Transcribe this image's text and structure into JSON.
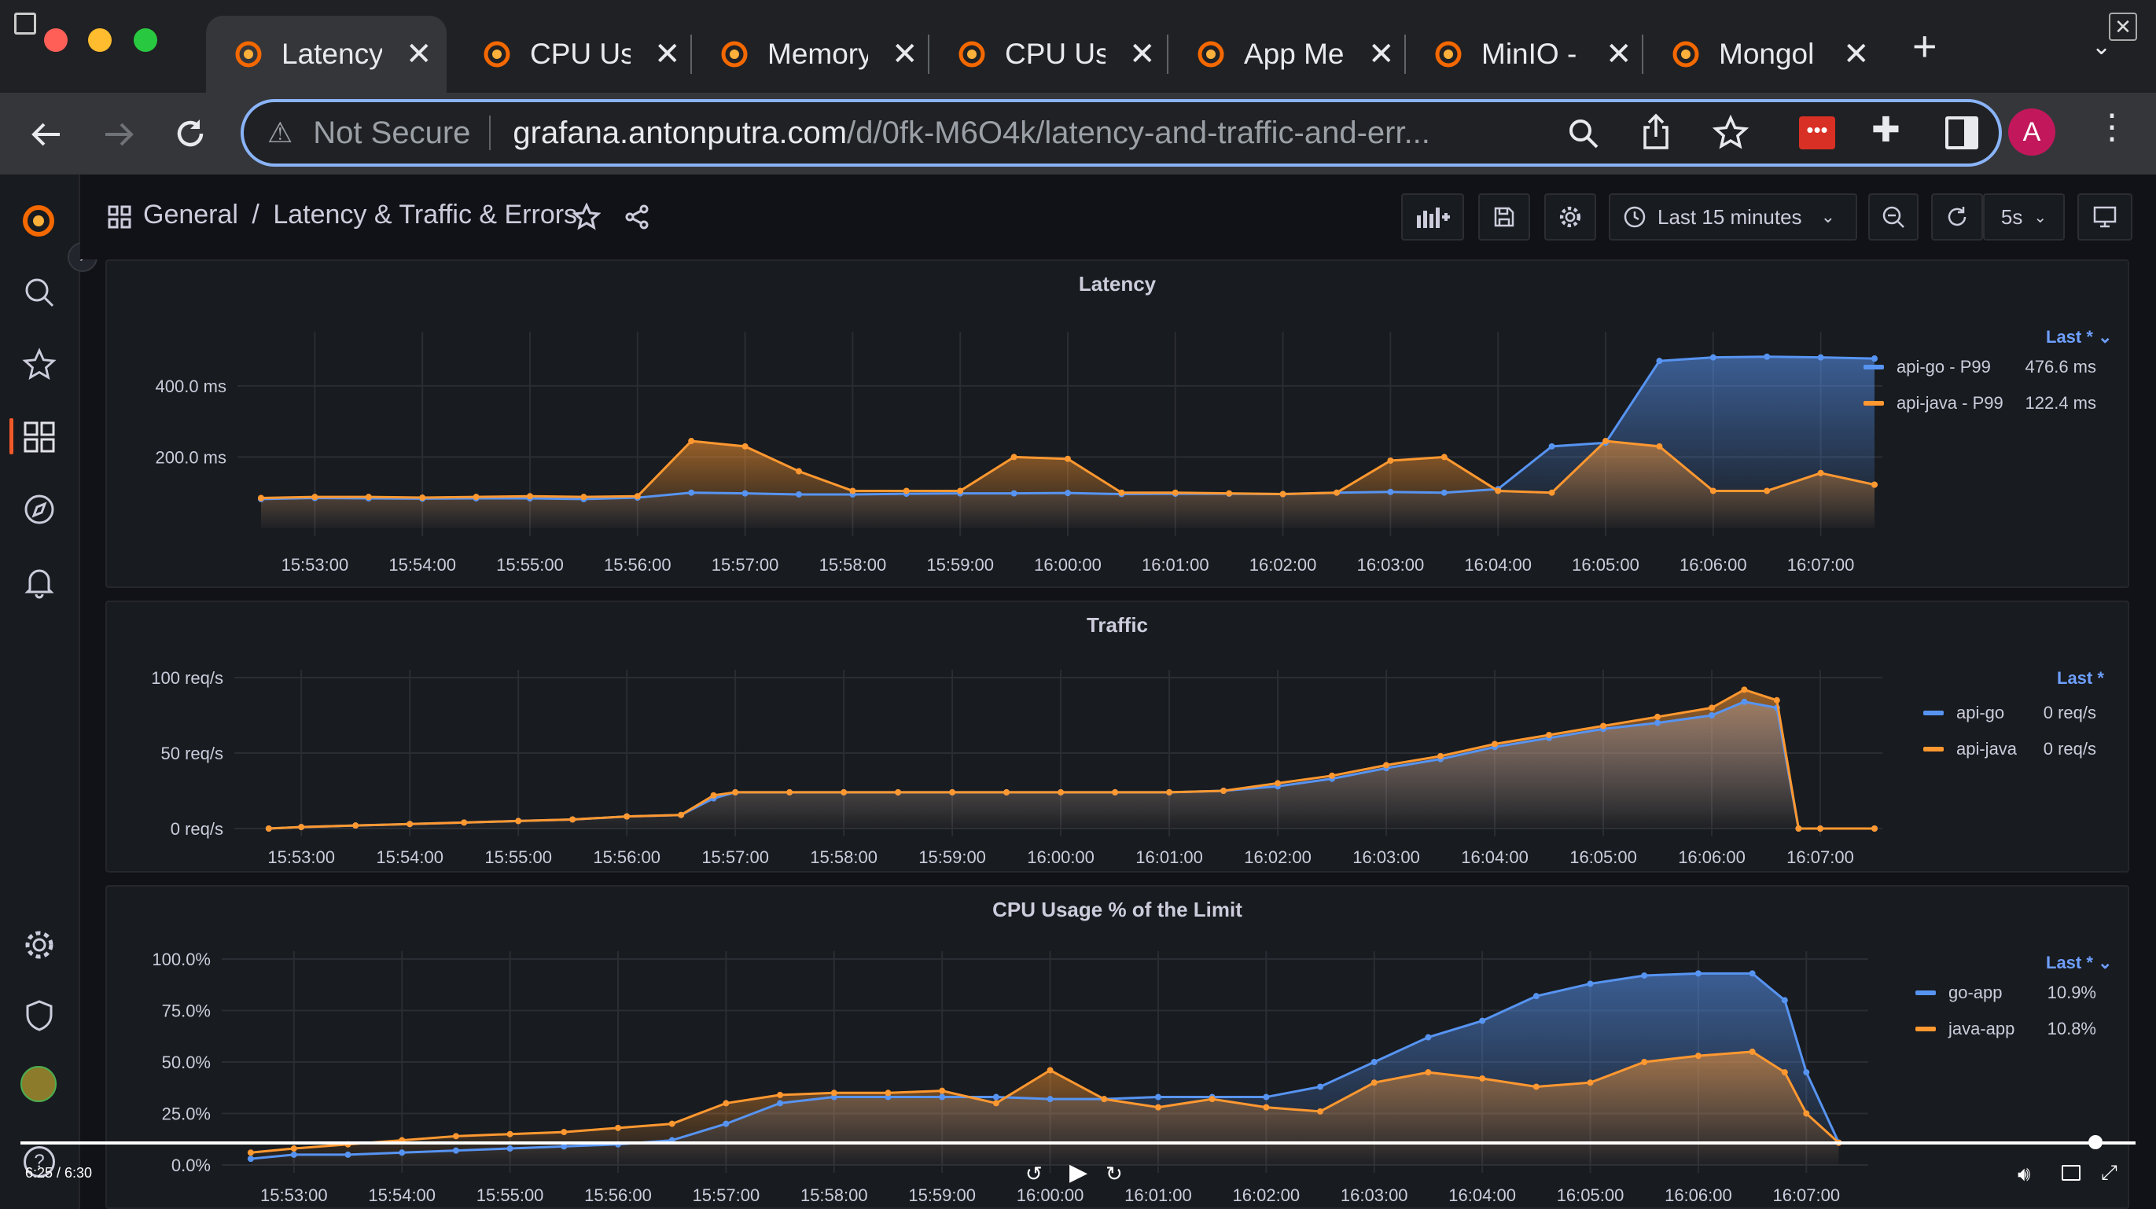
{
  "browser": {
    "tabs": [
      {
        "label": "Latency",
        "active": true
      },
      {
        "label": "CPU Us"
      },
      {
        "label": "Memory"
      },
      {
        "label": "CPU Us"
      },
      {
        "label": "App Me"
      },
      {
        "label": "MinIO -"
      },
      {
        "label": "Mongol"
      }
    ],
    "not_secure": "Not Secure",
    "url_host": "grafana.antonputra.com",
    "url_path": "/d/0fk-M6O4k/latency-and-traffic-and-err...",
    "profile_initial": "A"
  },
  "dashboard": {
    "folder": "General",
    "separator": "/",
    "title": "Latency & Traffic & Errors",
    "time_range": "Last 15 minutes",
    "refresh": "5s"
  },
  "colors": {
    "blue": "#5794f2",
    "orange": "#ff9830"
  },
  "panels": {
    "latency": {
      "legend_header": "Last * ⌄",
      "legend": [
        {
          "name": "api-go - P99",
          "value": "476.6 ms"
        },
        {
          "name": "api-java - P99",
          "value": "122.4 ms"
        }
      ]
    },
    "traffic": {
      "legend_header": "Last *",
      "legend": [
        {
          "name": "api-go",
          "value": "0 req/s"
        },
        {
          "name": "api-java",
          "value": "0 req/s"
        }
      ]
    },
    "cpu": {
      "legend_header": "Last * ⌄",
      "legend": [
        {
          "name": "go-app",
          "value": "10.9%"
        },
        {
          "name": "java-app",
          "value": "10.8%"
        }
      ]
    }
  },
  "video": {
    "time": "6:25 / 6:30"
  },
  "chart_data": [
    {
      "type": "area",
      "title": "Latency",
      "y_ticks": [
        "400.0 ms",
        "200.0 ms"
      ],
      "ylim": [
        0,
        530
      ],
      "x_ticks": [
        "15:53:00",
        "15:54:00",
        "15:55:00",
        "15:56:00",
        "15:57:00",
        "15:58:00",
        "15:59:00",
        "16:00:00",
        "16:01:00",
        "16:02:00",
        "16:03:00",
        "16:04:00",
        "16:05:00",
        "16:06:00",
        "16:07:00"
      ],
      "x_unit": "minutes from 15:53:00",
      "x": [
        -0.5,
        0,
        0.5,
        1,
        1.5,
        2,
        2.5,
        3,
        3.5,
        4,
        4.5,
        5,
        5.5,
        6,
        6.5,
        7,
        7.5,
        8,
        8.5,
        9,
        9.5,
        10,
        10.5,
        11,
        11.5,
        12,
        12.5,
        13,
        13.5,
        14,
        14.5,
        14.5
      ],
      "series": [
        {
          "name": "api-go - P99",
          "color": "#5794f2",
          "values": [
            82,
            85,
            84,
            83,
            84,
            84,
            82,
            86,
            100,
            98,
            95,
            95,
            97,
            98,
            98,
            99,
            96,
            97,
            97,
            96,
            100,
            102,
            100,
            110,
            230,
            240,
            470,
            480,
            482,
            480,
            476.6,
            476.6
          ]
        },
        {
          "name": "api-java - P99",
          "color": "#ff9830",
          "values": [
            85,
            88,
            88,
            86,
            88,
            90,
            88,
            90,
            245,
            230,
            160,
            105,
            105,
            105,
            200,
            195,
            100,
            100,
            98,
            96,
            100,
            190,
            200,
            105,
            100,
            245,
            230,
            105,
            105,
            155,
            122.4,
            122.4
          ]
        }
      ]
    },
    {
      "type": "area",
      "title": "Traffic",
      "y_ticks": [
        "100 req/s",
        "50 req/s",
        "0 req/s"
      ],
      "ylim": [
        0,
        100
      ],
      "x_ticks": [
        "15:53:00",
        "15:54:00",
        "15:55:00",
        "15:56:00",
        "15:57:00",
        "15:58:00",
        "15:59:00",
        "16:00:00",
        "16:01:00",
        "16:02:00",
        "16:03:00",
        "16:04:00",
        "16:05:00",
        "16:06:00",
        "16:07:00"
      ],
      "x": [
        -0.3,
        0,
        0.5,
        1,
        1.5,
        2,
        2.5,
        3,
        3.5,
        3.8,
        4,
        4.5,
        5,
        5.5,
        6,
        6.5,
        7,
        7.5,
        8,
        8.5,
        9,
        9.5,
        10,
        10.5,
        11,
        11.5,
        12,
        12.5,
        13,
        13.3,
        13.6,
        13.8,
        14,
        14.5
      ],
      "series": [
        {
          "name": "api-go",
          "color": "#5794f2",
          "values": [
            0,
            1,
            2,
            3,
            4,
            5,
            6,
            8,
            9,
            20,
            24,
            24,
            24,
            24,
            24,
            24,
            24,
            24,
            24,
            25,
            28,
            33,
            40,
            46,
            54,
            60,
            66,
            70,
            75,
            84,
            80,
            0,
            0,
            0
          ]
        },
        {
          "name": "api-java",
          "color": "#ff9830",
          "values": [
            0,
            1,
            2,
            3,
            4,
            5,
            6,
            8,
            9,
            22,
            24,
            24,
            24,
            24,
            24,
            24,
            24,
            24,
            24,
            25,
            30,
            35,
            42,
            48,
            56,
            62,
            68,
            74,
            80,
            92,
            85,
            0,
            0,
            0
          ]
        }
      ]
    },
    {
      "type": "area",
      "title": "CPU Usage % of the Limit",
      "y_ticks": [
        "100.0%",
        "75.0%",
        "50.0%",
        "25.0%",
        "0.0%"
      ],
      "ylim": [
        0,
        100
      ],
      "x_ticks": [
        "15:53:00",
        "15:54:00",
        "15:55:00",
        "15:56:00",
        "15:57:00",
        "15:58:00",
        "15:59:00",
        "16:00:00",
        "16:01:00",
        "16:02:00",
        "16:03:00",
        "16:04:00",
        "16:05:00",
        "16:06:00",
        "16:07:00"
      ],
      "x": [
        -0.4,
        0,
        0.5,
        1,
        1.5,
        2,
        2.5,
        3,
        3.5,
        4,
        4.5,
        5,
        5.5,
        6,
        6.5,
        7,
        7.5,
        8,
        8.5,
        9,
        9.5,
        10,
        10.5,
        11,
        11.5,
        12,
        12.5,
        13,
        13.5,
        13.8,
        14,
        14.3
      ],
      "series": [
        {
          "name": "go-app",
          "color": "#5794f2",
          "values": [
            3,
            5,
            5,
            6,
            7,
            8,
            9,
            10,
            12,
            20,
            30,
            33,
            33,
            33,
            33,
            32,
            32,
            33,
            33,
            33,
            38,
            50,
            62,
            70,
            82,
            88,
            92,
            93,
            93,
            80,
            45,
            10.9
          ]
        },
        {
          "name": "java-app",
          "color": "#ff9830",
          "values": [
            6,
            8,
            10,
            12,
            14,
            15,
            16,
            18,
            20,
            30,
            34,
            35,
            35,
            36,
            30,
            46,
            32,
            28,
            32,
            28,
            26,
            40,
            45,
            42,
            38,
            40,
            50,
            53,
            55,
            45,
            25,
            10.8
          ]
        }
      ]
    }
  ]
}
